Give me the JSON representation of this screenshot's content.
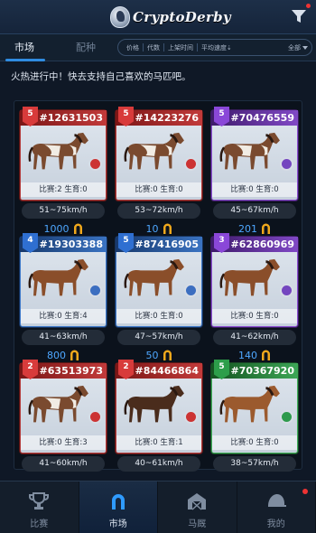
{
  "header": {
    "app_name": "CryptoDerby"
  },
  "tabs": {
    "market": "市场",
    "breeding": "配种"
  },
  "sort": {
    "items": [
      "价格",
      "代数",
      "上架时间",
      "平均速度⇣"
    ],
    "filter_value": "全部"
  },
  "banner": "火热进行中！快去支持自己喜欢的马匹吧。",
  "colors": {
    "red": "#c23a3a",
    "blue": "#3a73c2",
    "purple": "#8149c6",
    "green": "#3da656",
    "price": "#4ea7ff"
  },
  "horses": [
    {
      "id": "#12631503",
      "gen": "5",
      "rarity": "red",
      "coat": "pinto",
      "stats": "比赛:2  生育:0",
      "speed": "51~75km/h",
      "price": "1000"
    },
    {
      "id": "#14223276",
      "gen": "5",
      "rarity": "red",
      "coat": "pinto",
      "stats": "比赛:0  生育:0",
      "speed": "53~72km/h",
      "price": "10"
    },
    {
      "id": "#70476559",
      "gen": "5",
      "rarity": "purple",
      "coat": "pinto",
      "stats": "比赛:0  生育:0",
      "speed": "45~67km/h",
      "price": "201"
    },
    {
      "id": "#19303388",
      "gen": "4",
      "rarity": "blue",
      "coat": "bay",
      "stats": "比赛:0  生育:4",
      "speed": "41~63km/h",
      "price": "800"
    },
    {
      "id": "#87416905",
      "gen": "5",
      "rarity": "blue",
      "coat": "bay",
      "stats": "比赛:0  生育:0",
      "speed": "47~57km/h",
      "price": "50"
    },
    {
      "id": "#62860969",
      "gen": "3",
      "rarity": "purple",
      "coat": "bay",
      "stats": "比赛:0  生育:0",
      "speed": "41~62km/h",
      "price": "140"
    },
    {
      "id": "#63513973",
      "gen": "2",
      "rarity": "red",
      "coat": "pinto",
      "stats": "比赛:0  生育:3",
      "speed": "41~60km/h",
      "price": ""
    },
    {
      "id": "#84466864",
      "gen": "2",
      "rarity": "red",
      "coat": "dark",
      "stats": "比赛:0  生育:1",
      "speed": "40~61km/h",
      "price": ""
    },
    {
      "id": "#70367920",
      "gen": "5",
      "rarity": "green",
      "coat": "chestnut",
      "stats": "比赛:0  生育:0",
      "speed": "38~57km/h",
      "price": ""
    }
  ],
  "bottom_nav": [
    {
      "label": "比赛",
      "icon": "trophy-icon"
    },
    {
      "label": "市场",
      "icon": "horseshoe-icon"
    },
    {
      "label": "马厩",
      "icon": "stable-icon"
    },
    {
      "label": "我的",
      "icon": "helmet-icon"
    }
  ]
}
